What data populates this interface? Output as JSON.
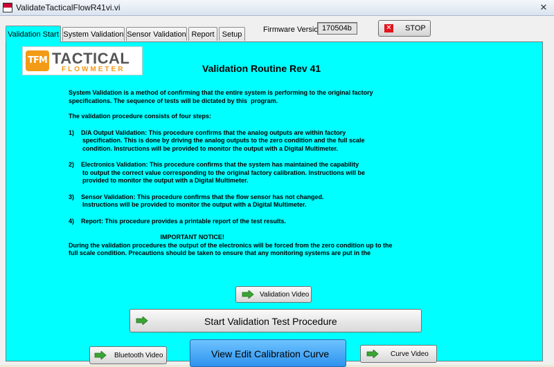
{
  "window": {
    "title": "ValidateTacticalFlowR41vi.vi",
    "close_glyph": "✕"
  },
  "tabs": [
    {
      "label": "Validation Start",
      "active": true
    },
    {
      "label": "System Validation",
      "active": false
    },
    {
      "label": "Sensor Validation",
      "active": false
    },
    {
      "label": "Report",
      "active": false
    },
    {
      "label": "Setup",
      "active": false
    }
  ],
  "firmware": {
    "label": "Firmware Version",
    "value": "170504b"
  },
  "stop_button": {
    "label": "STOP",
    "icon": "close-icon"
  },
  "logo": {
    "badge": "TFM",
    "top": "TACTICAL",
    "bottom": "FLOWMETER"
  },
  "heading": "Validation Routine Rev 41",
  "paragraphs": [
    "System Validation is a method of confirming that the entire system is performing to the original factory\nspecifications. The sequence of tests will be dictated by this  program.",
    "The validation procedure consists of four steps:",
    "1)    D/A Output Validation: This procedure confirms that the analog outputs are within factory\n        specification. This is done by driving the analog outputs to the zero condition and the full scale\n        condition. Instructions will be provided to monitor the output with a Digital Multimeter.",
    "2)    Electronics Validation: This procedure confirms that the system has maintained the capability\n        to output the correct value corresponding to the original factory calibration. Instructions will be\n        provided to monitor the output with a Digital Multimeter.",
    "3)    Sensor Validation: This procedure confirms that the flow sensor has not changed.\n        Instructions will be provided to monitor the output with a Digital Multimeter.",
    "4)    Report: This procedure provides a printable report of the test results.",
    "                                                     IMPORTANT NOTICE!\nDuring the validation procedures the output of the electronics will be forced from the zero condition up to the\nfull scale condition. Precautions should be taken to ensure that any monitoring systems are put in the"
  ],
  "buttons": {
    "validation_video": "Validation Video",
    "start_procedure": "Start  Validation Test Procedure",
    "bluetooth_video": "Bluetooth Video",
    "edit_calibration": "View Edit Calibration Curve",
    "curve_video": "Curve Video"
  },
  "colors": {
    "panel": "#00ffff",
    "accent_blue": "#2e93ee",
    "arrow_green": "#3aa635",
    "stop_red": "#e0141e",
    "logo_orange": "#f39a16"
  }
}
